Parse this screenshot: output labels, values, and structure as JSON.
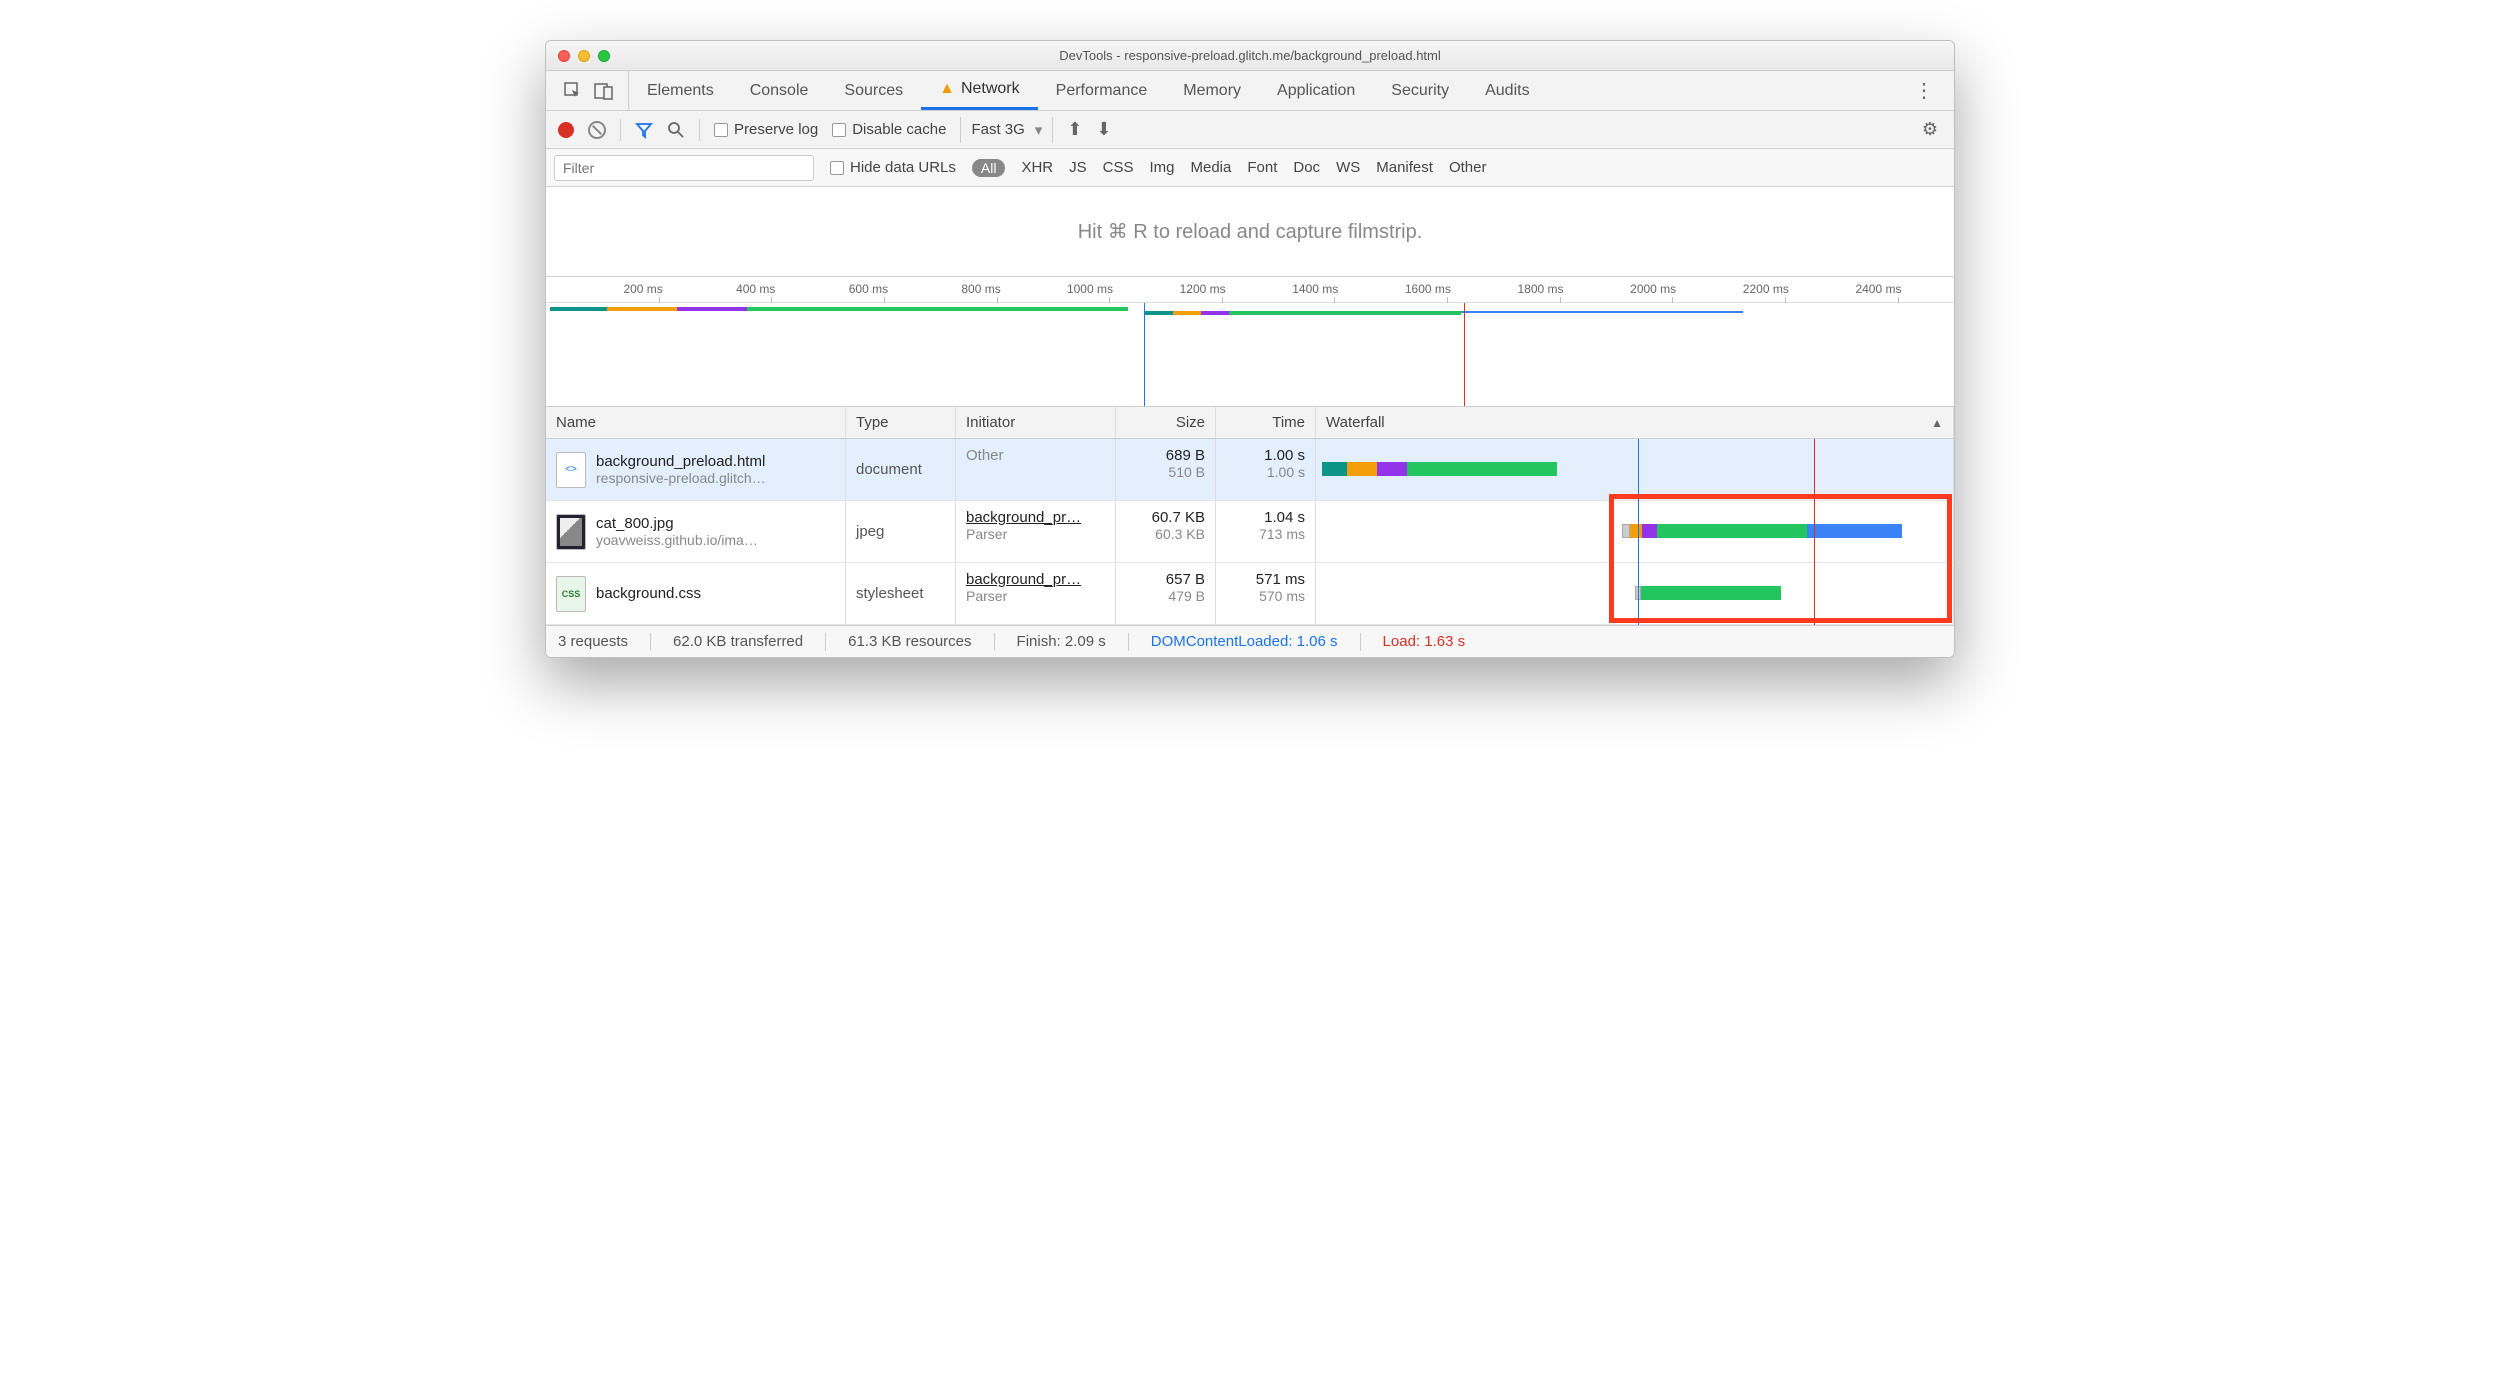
{
  "window": {
    "title": "DevTools - responsive-preload.glitch.me/background_preload.html"
  },
  "tabs": [
    "Elements",
    "Console",
    "Sources",
    "Network",
    "Performance",
    "Memory",
    "Application",
    "Security",
    "Audits"
  ],
  "activeTab": "Network",
  "toolbar": {
    "preserve_log": "Preserve log",
    "disable_cache": "Disable cache",
    "throttle": "Fast 3G"
  },
  "filterbar": {
    "placeholder": "Filter",
    "hide_data_urls": "Hide data URLs",
    "types": [
      "All",
      "XHR",
      "JS",
      "CSS",
      "Img",
      "Media",
      "Font",
      "Doc",
      "WS",
      "Manifest",
      "Other"
    ],
    "activeType": "All"
  },
  "filmstrip_hint": "Hit ⌘ R to reload and capture filmstrip.",
  "timeline_ticks": [
    "200 ms",
    "400 ms",
    "600 ms",
    "800 ms",
    "1000 ms",
    "1200 ms",
    "1400 ms",
    "1600 ms",
    "1800 ms",
    "2000 ms",
    "2200 ms",
    "2400 ms"
  ],
  "columns": {
    "name": "Name",
    "type": "Type",
    "initiator": "Initiator",
    "size": "Size",
    "time": "Time",
    "waterfall": "Waterfall"
  },
  "rows": [
    {
      "name": "background_preload.html",
      "sub": "responsive-preload.glitch…",
      "type": "document",
      "initiator": "Other",
      "initiator_sub": "",
      "size": "689 B",
      "size_sub": "510 B",
      "time": "1.00 s",
      "time_sub": "1.00 s",
      "icon": "html"
    },
    {
      "name": "cat_800.jpg",
      "sub": "yoavweiss.github.io/ima…",
      "type": "jpeg",
      "initiator": "background_pr…",
      "initiator_sub": "Parser",
      "size": "60.7 KB",
      "size_sub": "60.3 KB",
      "time": "1.04 s",
      "time_sub": "713 ms",
      "icon": "jpg"
    },
    {
      "name": "background.css",
      "sub": "",
      "type": "stylesheet",
      "initiator": "background_pr…",
      "initiator_sub": "Parser",
      "size": "657 B",
      "size_sub": "479 B",
      "time": "571 ms",
      "time_sub": "570 ms",
      "icon": "css"
    }
  ],
  "status": {
    "requests": "3 requests",
    "transferred": "62.0 KB transferred",
    "resources": "61.3 KB resources",
    "finish": "Finish: 2.09 s",
    "dcl": "DOMContentLoaded: 1.06 s",
    "load": "Load: 1.63 s"
  }
}
